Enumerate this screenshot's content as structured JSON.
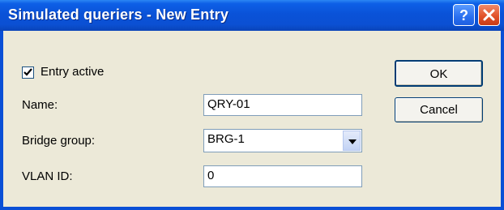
{
  "window": {
    "title": "Simulated queriers - New Entry",
    "help_button": "?",
    "close_button": "X"
  },
  "form": {
    "entry_active": {
      "label": "Entry active",
      "checked": true
    },
    "name": {
      "label": "Name:",
      "value": "QRY-01"
    },
    "bridge_group": {
      "label": "Bridge group:",
      "value": "BRG-1"
    },
    "vlan_id": {
      "label": "VLAN ID:",
      "value": "0"
    }
  },
  "buttons": {
    "ok": "OK",
    "cancel": "Cancel"
  },
  "icons": {
    "help": "question-mark-icon",
    "close": "close-x-icon",
    "check": "checkmark-icon",
    "dropdown": "chevron-down-icon"
  },
  "colors": {
    "titlebar": "#0a52d8",
    "dialog_background": "#ece9d8",
    "close_button": "#e2532a",
    "input_border": "#7f9db9"
  }
}
